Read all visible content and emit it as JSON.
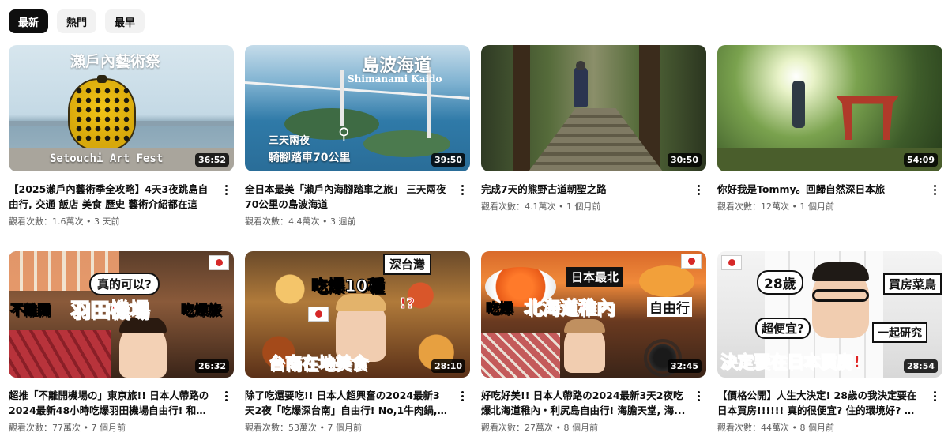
{
  "filters": [
    {
      "label": "最新",
      "active": true
    },
    {
      "label": "熱門",
      "active": false
    },
    {
      "label": "最早",
      "active": false
    }
  ],
  "videos": [
    {
      "title": "【2025瀨戶內藝術季全攻略】4天3夜跳島自由行, 交通 飯店 美食 歷史 藝術介紹都在這",
      "views": "觀看次數：1.6萬次",
      "age": "3 天前",
      "duration": "36:52",
      "overlay_top": "瀨戶內藝術祭",
      "overlay_bottom": "Setouchi Art Fest"
    },
    {
      "title": "全日本最美「瀨戶內海腳踏車之旅」 三天兩夜70公里の島波海道",
      "views": "觀看次數：4.4萬次",
      "age": "3 週前",
      "duration": "39:50",
      "overlay_top": "島波海道",
      "overlay_sub": "Shimanami Kaido",
      "overlay_left1": "三天兩夜",
      "overlay_left2": "騎腳踏車70公里"
    },
    {
      "title": "完成7天的熊野古道朝聖之路",
      "views": "觀看次數：4.1萬次",
      "age": "1 個月前",
      "duration": "30:50"
    },
    {
      "title": "你好我是Tommy。回歸自然深日本旅",
      "views": "觀看次數：12萬次",
      "age": "1 個月前",
      "duration": "54:09"
    },
    {
      "title": "超推「不離開機場の」東京旅!! 日本人帶路の2024最新48小時吃爆羽田機場自由行! 和牛...",
      "views": "觀看次數：77萬次",
      "age": "7 個月前",
      "duration": "26:32",
      "overlay_a": "真的可以?",
      "overlay_b1": "不離開",
      "overlay_b2": "羽田機場",
      "overlay_b3": "吃爆旅"
    },
    {
      "title": "除了吃還要吃!! 日本人超興奮の2024最新3天2夜「吃爆深台南」自由行! No,1牛肉鍋, 鱔...",
      "views": "觀看次數：53萬次",
      "age": "7 個月前",
      "duration": "28:10",
      "overlay_a": "深台灣",
      "overlay_b": "吃爆10種",
      "overlay_c": "!?",
      "overlay_d": "台南在地美食"
    },
    {
      "title": "好吃好美!! 日本人帶路の2024最新3天2夜吃爆北海道稚內・利尻島自由行! 海膽天堂, 海...",
      "views": "觀看次數：27萬次",
      "age": "8 個月前",
      "duration": "32:45",
      "overlay_a": "日本最北",
      "overlay_b1": "吃爆",
      "overlay_b2": "北海道稚內",
      "overlay_b3": "自由行"
    },
    {
      "title": "【價格公開】人生大決定! 28歲の我決定要在日本買房!!!!!! 真的很便宜? 住的環境好? 一起...",
      "views": "觀看次數：44萬次",
      "age": "8 個月前",
      "duration": "28:54",
      "overlay_a": "28歲",
      "overlay_b": "買房菜鳥",
      "overlay_c": "超便宜?",
      "overlay_d": "一起研究",
      "overlay_e": "決定要在日本買房!"
    }
  ],
  "separator": "•",
  "colors": {
    "chip_active_bg": "#0f0f0f",
    "chip_bg": "#f2f2f2",
    "meta_text": "#606060"
  }
}
